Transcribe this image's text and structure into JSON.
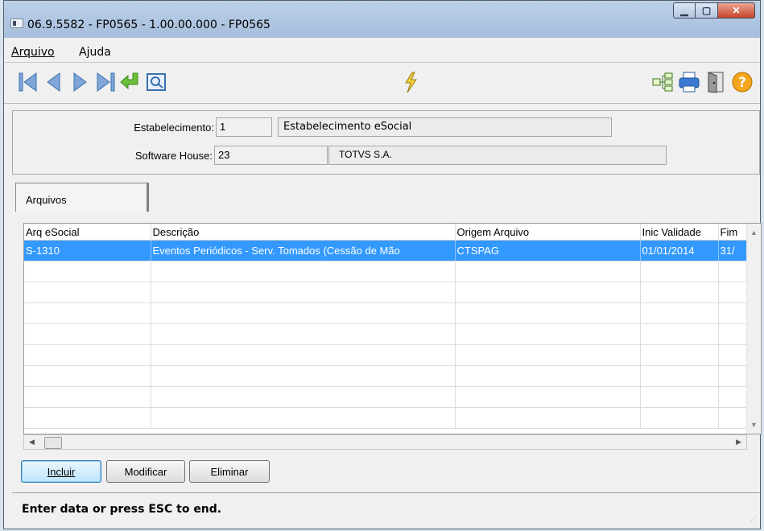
{
  "window": {
    "title": "06.9.5582 - FP0565 - 1.00.00.000 - FP0565"
  },
  "menu": {
    "items": [
      {
        "label": "Arquivo",
        "accel_index": 0
      },
      {
        "label": "Ajuda",
        "accel_index": 2
      }
    ]
  },
  "toolbar": {
    "left_icons": [
      "first-record-icon",
      "previous-record-icon",
      "next-record-icon",
      "last-record-icon",
      "goto-enter-icon",
      "search-zoom-icon"
    ],
    "center_icon": "lightning-icon",
    "right_icons": [
      "tree-view-icon",
      "print-icon",
      "exit-door-icon",
      "help-icon"
    ]
  },
  "form": {
    "estabelecimento": {
      "label": "Estabelecimento:",
      "code": "1",
      "name": "Estabelecimento eSocial"
    },
    "software_house": {
      "label": "Software House:",
      "code": "23",
      "name": "TOTVS S.A."
    }
  },
  "tabs": [
    {
      "label": "Arquivos"
    }
  ],
  "grid": {
    "columns": [
      "Arq eSocial",
      "Descrição",
      "Origem Arquivo",
      "Inic Validade",
      "Fim"
    ],
    "rows": [
      [
        "S-1310",
        "Eventos Periódicos - Serv. Tomados (Cessão de Mão",
        "CTSPAG",
        "01/01/2014",
        "31/"
      ]
    ]
  },
  "buttons": {
    "incluir": "Incluir",
    "modificar": "Modificar",
    "eliminar": "Eliminar"
  },
  "status": {
    "message": "Enter data or press ESC to end."
  },
  "colors": {
    "selection": "#3399ff",
    "title_bar": "#bcd0e8",
    "close_button": "#c9442b"
  }
}
